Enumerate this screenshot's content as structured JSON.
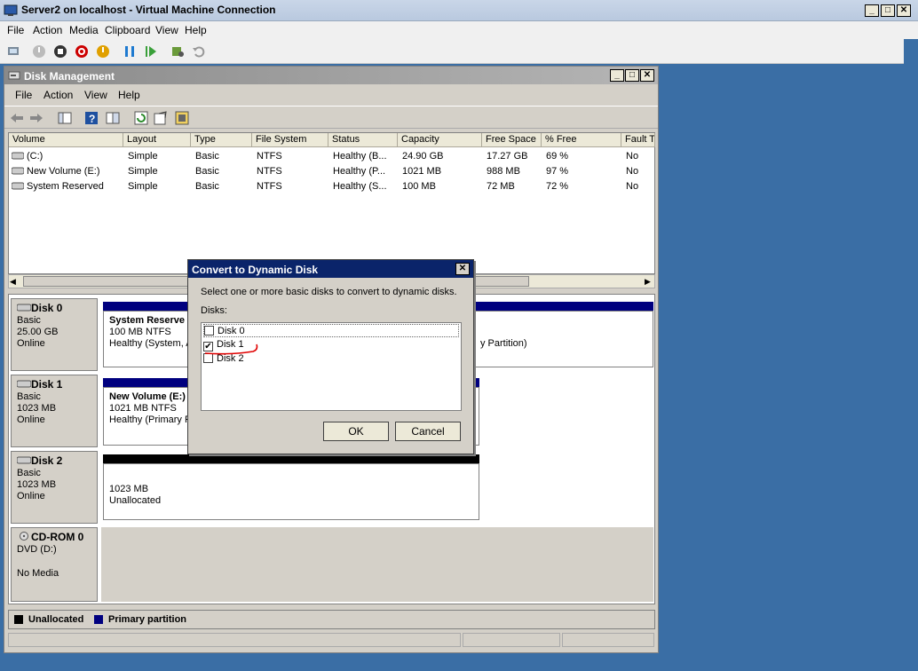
{
  "vm": {
    "title": "Server2 on localhost - Virtual Machine Connection",
    "menu": [
      "File",
      "Action",
      "Media",
      "Clipboard",
      "View",
      "Help"
    ]
  },
  "dm": {
    "title": "Disk Management",
    "menu": [
      "File",
      "Action",
      "View",
      "Help"
    ],
    "columns": [
      "Volume",
      "Layout",
      "Type",
      "File System",
      "Status",
      "Capacity",
      "Free Space",
      "% Free",
      "Fault T"
    ],
    "rows": [
      [
        "(C:)",
        "Simple",
        "Basic",
        "NTFS",
        "Healthy (B...",
        "24.90 GB",
        "17.27 GB",
        "69 %",
        "No"
      ],
      [
        "New Volume (E:)",
        "Simple",
        "Basic",
        "NTFS",
        "Healthy (P...",
        "1021 MB",
        "988 MB",
        "97 %",
        "No"
      ],
      [
        "System Reserved",
        "Simple",
        "Basic",
        "NTFS",
        "Healthy (S...",
        "100 MB",
        "72 MB",
        "72 %",
        "No"
      ]
    ],
    "disks": [
      {
        "name": "Disk 0",
        "type": "Basic",
        "size": "25.00 GB",
        "state": "Online",
        "part_title": "System Reserve",
        "part_line1": "100 MB NTFS",
        "part_line2": "Healthy (System, A",
        "part2_text": "y Partition)"
      },
      {
        "name": "Disk 1",
        "type": "Basic",
        "size": "1023 MB",
        "state": "Online",
        "part_title": "New Volume  (E:)",
        "part_line1": "1021 MB NTFS",
        "part_line2": "Healthy (Primary Pa"
      },
      {
        "name": "Disk 2",
        "type": "Basic",
        "size": "1023 MB",
        "state": "Online",
        "part_line1": "1023 MB",
        "part_line2": "Unallocated"
      },
      {
        "name": "CD-ROM 0",
        "type": "DVD (D:)",
        "state": "No Media"
      }
    ],
    "legend": {
      "unallocated": "Unallocated",
      "primary": "Primary partition"
    }
  },
  "dialog": {
    "title": "Convert to Dynamic Disk",
    "instruction": "Select one or more basic disks to convert to dynamic disks.",
    "list_label": "Disks:",
    "items": [
      {
        "label": "Disk 0",
        "checked": false
      },
      {
        "label": "Disk 1",
        "checked": true
      },
      {
        "label": "Disk 2",
        "checked": false
      }
    ],
    "ok": "OK",
    "cancel": "Cancel"
  },
  "colors": {
    "primary_partition": "#00007f",
    "unallocated": "#000000",
    "dialog_title": "#0a246a",
    "annotation": "#e00000"
  }
}
